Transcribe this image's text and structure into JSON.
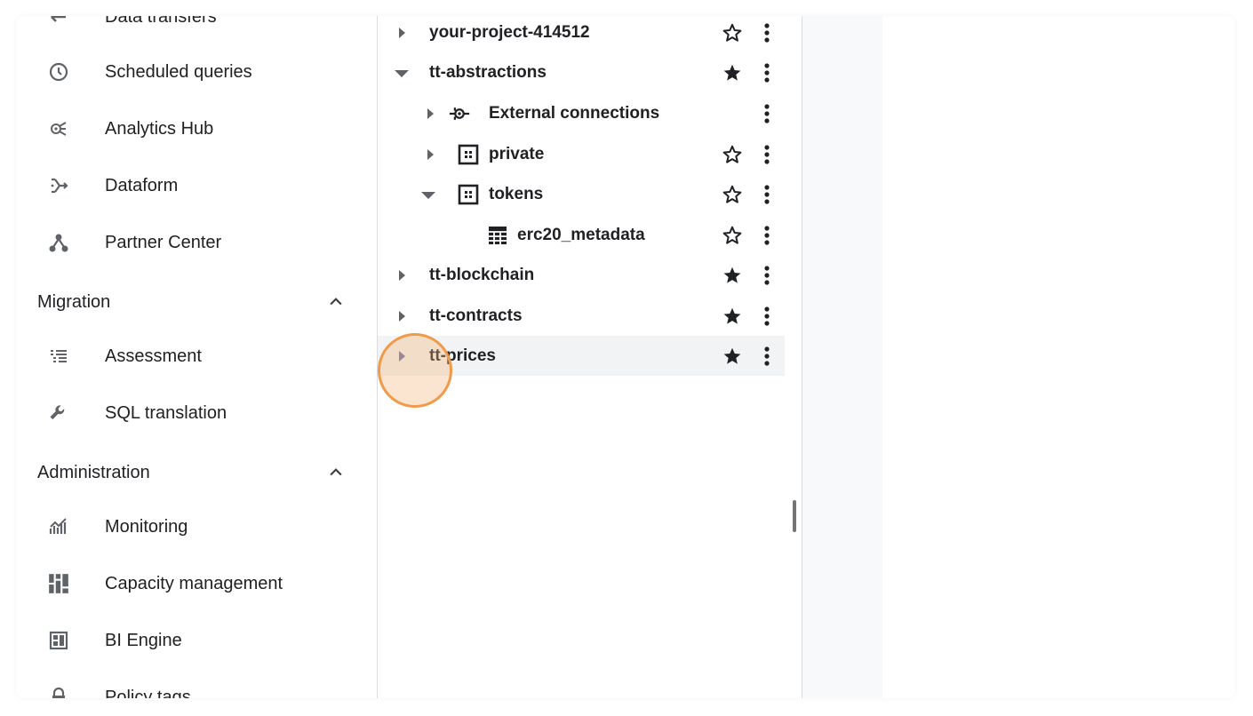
{
  "nav": {
    "items_top": [
      {
        "label": "Data transfers",
        "icon": "data-transfers-icon"
      },
      {
        "label": "Scheduled queries",
        "icon": "clock-icon"
      },
      {
        "label": "Analytics Hub",
        "icon": "analytics-hub-icon"
      },
      {
        "label": "Dataform",
        "icon": "dataform-icon"
      },
      {
        "label": "Partner Center",
        "icon": "partner-center-icon"
      }
    ],
    "migration": {
      "title": "Migration",
      "items": [
        {
          "label": "Assessment",
          "icon": "assessment-icon"
        },
        {
          "label": "SQL translation",
          "icon": "wrench-icon"
        }
      ]
    },
    "administration": {
      "title": "Administration",
      "items": [
        {
          "label": "Monitoring",
          "icon": "monitoring-icon"
        },
        {
          "label": "Capacity management",
          "icon": "capacity-icon"
        },
        {
          "label": "BI Engine",
          "icon": "bi-engine-icon"
        },
        {
          "label": "Policy tags",
          "icon": "lock-icon"
        }
      ]
    }
  },
  "tree": {
    "rows": [
      {
        "label": "your-project-414512",
        "expanded": false,
        "starred": false
      },
      {
        "label": "tt-abstractions",
        "expanded": true,
        "starred": true
      },
      {
        "label": "External connections",
        "expanded": false,
        "starred": null
      },
      {
        "label": "private",
        "expanded": false,
        "starred": false
      },
      {
        "label": "tokens",
        "expanded": true,
        "starred": false
      },
      {
        "label": "erc20_metadata",
        "starred": false
      },
      {
        "label": "tt-blockchain",
        "expanded": false,
        "starred": true
      },
      {
        "label": "tt-contracts",
        "expanded": false,
        "starred": true
      },
      {
        "label": "tt-prices",
        "expanded": false,
        "starred": true,
        "selected": true
      }
    ]
  },
  "colors": {
    "accent_click": "#f09a4a",
    "icon": "#5f6368",
    "selected_row": "#f1f3f4"
  }
}
